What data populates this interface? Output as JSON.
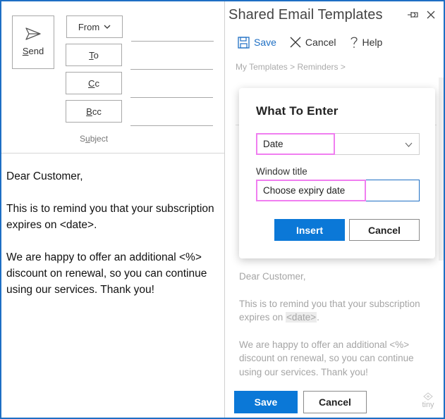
{
  "compose": {
    "send_label_first": "S",
    "send_label_rest": "end",
    "from_label": "From",
    "to_label_first": "T",
    "to_label_rest": "o",
    "cc_label_first": "C",
    "cc_label_rest": "c",
    "bcc_label_first": "B",
    "bcc_label_rest": "cc",
    "subject_label_pre": "S",
    "subject_label_u": "u",
    "subject_label_post": "bject",
    "body": {
      "greeting": "Dear Customer,",
      "paragraph1": "This is to remind you that your subscription expires on <date>.",
      "paragraph2": "We are happy to offer an additional <%> discount on renewal, so you can continue using our services. Thank you!"
    }
  },
  "pane": {
    "title": "Shared Email Templates",
    "icons": {
      "pin": "pin-icon",
      "close": "close-icon"
    },
    "toolbar": {
      "save_label": "Save",
      "cancel_label": "Cancel",
      "help_label": "Help"
    },
    "breadcrumb": "My Templates > Reminders >",
    "preview": {
      "greeting": "Dear Customer,",
      "p1_before": "This is to remind you that your subscription expires on ",
      "p1_placeholder": "<date>",
      "p1_after": ".",
      "p2": "We are happy to offer an additional <%> discount on renewal, so you can continue using our services. Thank you!"
    },
    "save_button": "Save",
    "cancel_button": "Cancel",
    "logo_text": "tiny"
  },
  "dialog": {
    "title": "What To Enter",
    "type_select_value": "Date",
    "window_title_label": "Window title",
    "window_title_value": "Choose expiry date",
    "insert_button": "Insert",
    "cancel_button": "Cancel",
    "highlight_color": "#f07ef0"
  },
  "colors": {
    "accent": "#0b78d7",
    "window_border": "#1e6fc4"
  }
}
